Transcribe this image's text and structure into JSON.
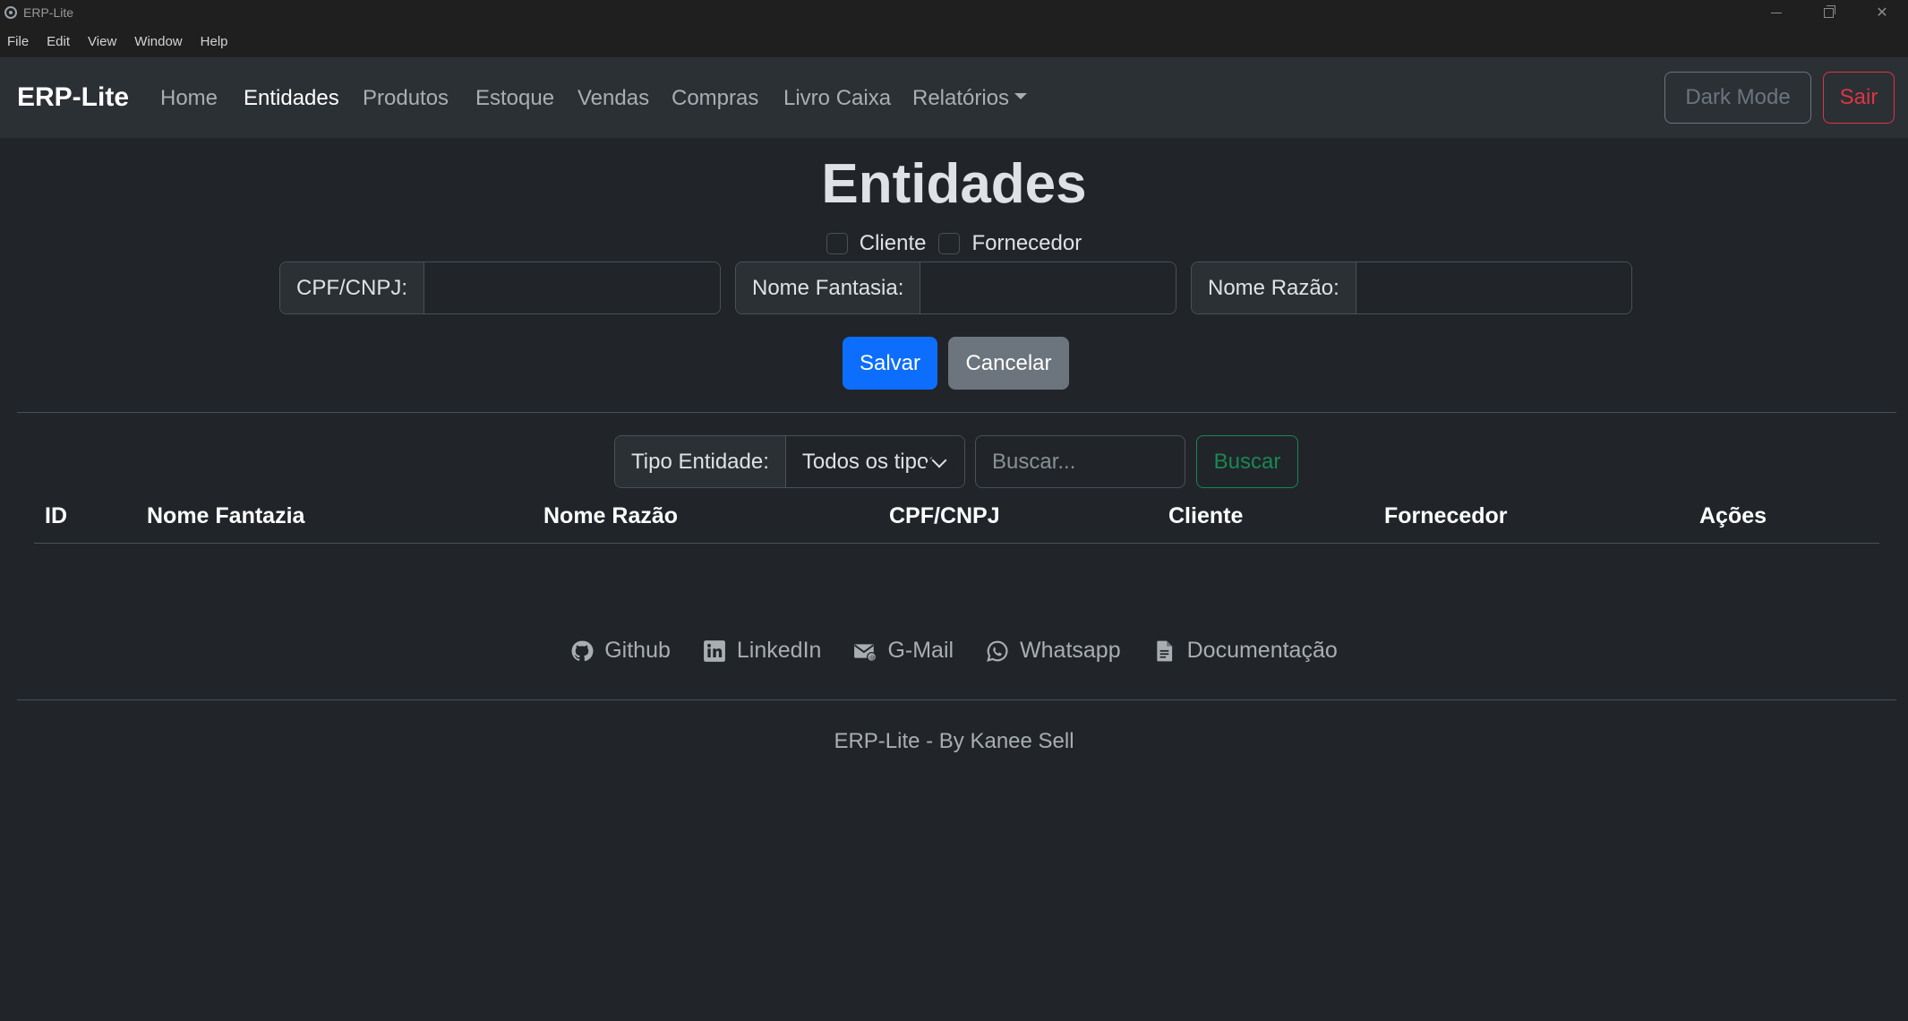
{
  "window": {
    "title": "ERP-Lite"
  },
  "menubar": {
    "items": [
      "File",
      "Edit",
      "View",
      "Window",
      "Help"
    ]
  },
  "navbar": {
    "brand": "ERP-Lite",
    "links": [
      "Home",
      "Entidades",
      "Produtos",
      "Estoque",
      "Vendas",
      "Compras",
      "Livro Caixa",
      "Relatórios"
    ],
    "active": "Entidades",
    "dark_mode_label": "Dark Mode",
    "logout_label": "Sair"
  },
  "page": {
    "title": "Entidades",
    "checkbox_cliente": "Cliente",
    "checkbox_fornecedor": "Fornecedor",
    "field_cpf_label": "CPF/CNPJ:",
    "field_cpf_value": "",
    "field_fantasia_label": "Nome Fantasia:",
    "field_fantasia_value": "",
    "field_razao_label": "Nome Razão:",
    "field_razao_value": "",
    "save_label": "Salvar",
    "cancel_label": "Cancelar"
  },
  "filter": {
    "tipo_label": "Tipo Entidade:",
    "tipo_selected": "Todos os tipos",
    "search_placeholder": "Buscar...",
    "search_button": "Buscar"
  },
  "table": {
    "headers": [
      "ID",
      "Nome Fantazia",
      "Nome Razão",
      "CPF/CNPJ",
      "Cliente",
      "Fornecedor",
      "Ações"
    ],
    "rows": []
  },
  "footer": {
    "links": [
      {
        "label": "Github",
        "icon": "github-icon"
      },
      {
        "label": "LinkedIn",
        "icon": "linkedin-icon"
      },
      {
        "label": "G-Mail",
        "icon": "mail-icon"
      },
      {
        "label": "Whatsapp",
        "icon": "whatsapp-icon"
      },
      {
        "label": "Documentação",
        "icon": "document-icon"
      }
    ],
    "copyright": "ERP-Lite - By Kanee Sell"
  },
  "colors": {
    "background": "#212529",
    "navbar": "#2b3035",
    "primary": "#0d6efd",
    "secondary": "#6c757d",
    "danger": "#dc3545",
    "success": "#198754"
  }
}
